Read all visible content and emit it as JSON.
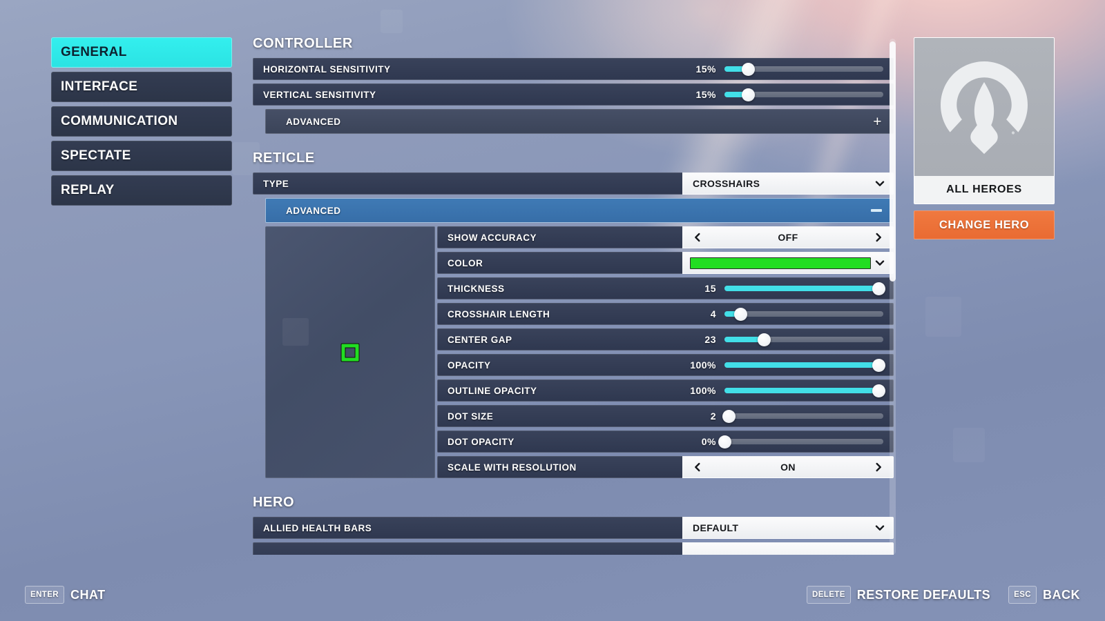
{
  "theme": {
    "accent_cyan": "#2be3e3",
    "slider_fill": "#42dfe8",
    "advanced_expanded_blue": "#3f7ab5",
    "change_hero_orange": "#e96b33",
    "crosshair_green": "#22dd22"
  },
  "sidebar": {
    "items": [
      {
        "label": "GENERAL",
        "active": true
      },
      {
        "label": "INTERFACE",
        "active": false
      },
      {
        "label": "COMMUNICATION",
        "active": false
      },
      {
        "label": "SPECTATE",
        "active": false
      },
      {
        "label": "REPLAY",
        "active": false
      }
    ]
  },
  "sections": {
    "controller": {
      "title": "CONTROLLER",
      "rows": [
        {
          "label": "HORIZONTAL SENSITIVITY",
          "value": "15%",
          "fill_pct": 15
        },
        {
          "label": "VERTICAL SENSITIVITY",
          "value": "15%",
          "fill_pct": 15
        }
      ],
      "advanced": {
        "label": "ADVANCED",
        "state": "collapsed",
        "sign": "+"
      }
    },
    "reticle": {
      "title": "RETICLE",
      "type_row": {
        "label": "TYPE",
        "value": "CROSSHAIRS"
      },
      "advanced": {
        "label": "ADVANCED",
        "state": "expanded",
        "sign": "−"
      },
      "rows": {
        "show_accuracy": {
          "label": "SHOW ACCURACY",
          "value": "OFF"
        },
        "color": {
          "label": "COLOR",
          "value": "#22dd22"
        },
        "thickness": {
          "label": "THICKNESS",
          "value": "15",
          "fill_pct": 97
        },
        "crosshair_length": {
          "label": "CROSSHAIR LENGTH",
          "value": "4",
          "fill_pct": 10
        },
        "center_gap": {
          "label": "CENTER GAP",
          "value": "23",
          "fill_pct": 25
        },
        "opacity": {
          "label": "OPACITY",
          "value": "100%",
          "fill_pct": 97
        },
        "outline_opacity": {
          "label": "OUTLINE OPACITY",
          "value": "100%",
          "fill_pct": 97
        },
        "dot_size": {
          "label": "DOT SIZE",
          "value": "2",
          "fill_pct": 3
        },
        "dot_opacity": {
          "label": "DOT OPACITY",
          "value": "0%",
          "fill_pct": 0
        },
        "scale_with_resolution": {
          "label": "SCALE WITH RESOLUTION",
          "value": "ON"
        }
      }
    },
    "hero": {
      "title": "HERO",
      "rows": [
        {
          "label": "ALLIED HEALTH BARS",
          "value": "DEFAULT"
        }
      ]
    }
  },
  "hero_panel": {
    "hero_name": "ALL HEROES",
    "change_hero_label": "CHANGE HERO",
    "logo_icon": "overwatch-logo-icon"
  },
  "footer": {
    "chat": {
      "key": "ENTER",
      "label": "CHAT"
    },
    "restore": {
      "key": "DELETE",
      "label": "RESTORE DEFAULTS"
    },
    "back": {
      "key": "ESC",
      "label": "BACK"
    }
  }
}
